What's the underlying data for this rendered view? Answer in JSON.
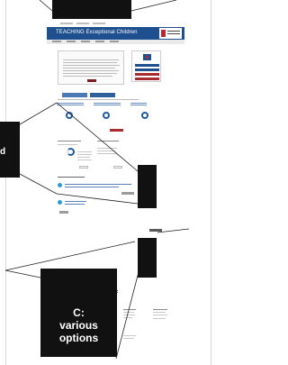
{
  "header": {
    "title": "TEACHING Exceptional Children"
  },
  "callouts": {
    "b_fragment_line1": "",
    "b_fragment_line2": "d",
    "c_label_line1": "C:",
    "c_label_line2": "various",
    "c_label_line3": "options"
  },
  "colors": {
    "brand_blue": "#1e4f8e",
    "brand_red": "#a72b31",
    "annotation_black": "#111111"
  },
  "icons": {
    "rings": [
      "progress-ring-icon",
      "progress-ring-icon",
      "progress-ring-icon"
    ],
    "badges": [
      "info-badge-icon",
      "info-badge-icon"
    ]
  }
}
